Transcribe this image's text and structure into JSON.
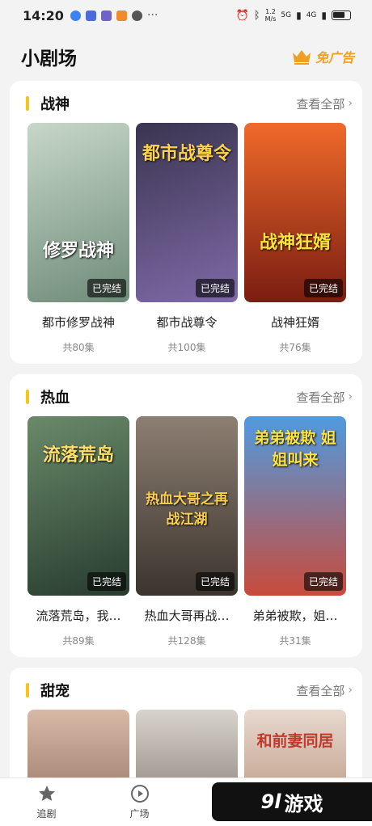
{
  "status_bar": {
    "time": "14:20",
    "speed": "1.2",
    "speed_unit": "M/s",
    "signal1": "5G",
    "signal2": "4G"
  },
  "header": {
    "title": "小剧场",
    "ad_free_label": "免广告"
  },
  "sections": [
    {
      "title": "战神",
      "see_all": "查看全部",
      "items": [
        {
          "title": "都市修罗战神",
          "episodes": "共80集",
          "status": "已完结",
          "poster_text": "修罗战神",
          "colors": [
            "#c7d7c9",
            "#6f8b7a"
          ]
        },
        {
          "title": "都市战尊令",
          "episodes": "共100集",
          "status": "已完结",
          "poster_text": "都市战尊令",
          "colors": [
            "#3a3550",
            "#7f6aa8"
          ]
        },
        {
          "title": "战神狂婿",
          "episodes": "共76集",
          "status": "已完结",
          "poster_text": "战神狂婿",
          "colors": [
            "#f06a2b",
            "#7a1d12"
          ]
        }
      ]
    },
    {
      "title": "热血",
      "see_all": "查看全部",
      "items": [
        {
          "title": "流落荒岛，我…",
          "episodes": "共89集",
          "status": "已完结",
          "poster_text": "流落荒岛",
          "colors": [
            "#6a8a6a",
            "#273b2e"
          ]
        },
        {
          "title": "热血大哥再战…",
          "episodes": "共128集",
          "status": "已完结",
          "poster_text": "热血大哥之再战江湖",
          "colors": [
            "#8d7f72",
            "#3b342e"
          ]
        },
        {
          "title": "弟弟被欺，姐…",
          "episodes": "共31集",
          "status": "已完结",
          "poster_text": "弟弟被欺 姐姐叫来",
          "colors": [
            "#4f9be0",
            "#c84b3c"
          ]
        }
      ]
    },
    {
      "title": "甜宠",
      "see_all": "查看全部",
      "items": [
        {
          "poster_text": "",
          "colors": [
            "#d8b9a6",
            "#8b6b5c"
          ]
        },
        {
          "poster_text": "",
          "colors": [
            "#d8d3cc",
            "#7c746b"
          ]
        },
        {
          "poster_text": "和前妻同居",
          "colors": [
            "#e8d9cf",
            "#b28b72"
          ]
        }
      ]
    }
  ],
  "bottom_nav": [
    {
      "label": "追剧",
      "icon": "star-icon"
    },
    {
      "label": "广场",
      "icon": "play-icon"
    }
  ],
  "watermark": {
    "number": "9l",
    "text": "游戏"
  },
  "colors": {
    "accent": "#f5c518",
    "ad_free": "#f0a020",
    "background": "#f3f3f3"
  }
}
